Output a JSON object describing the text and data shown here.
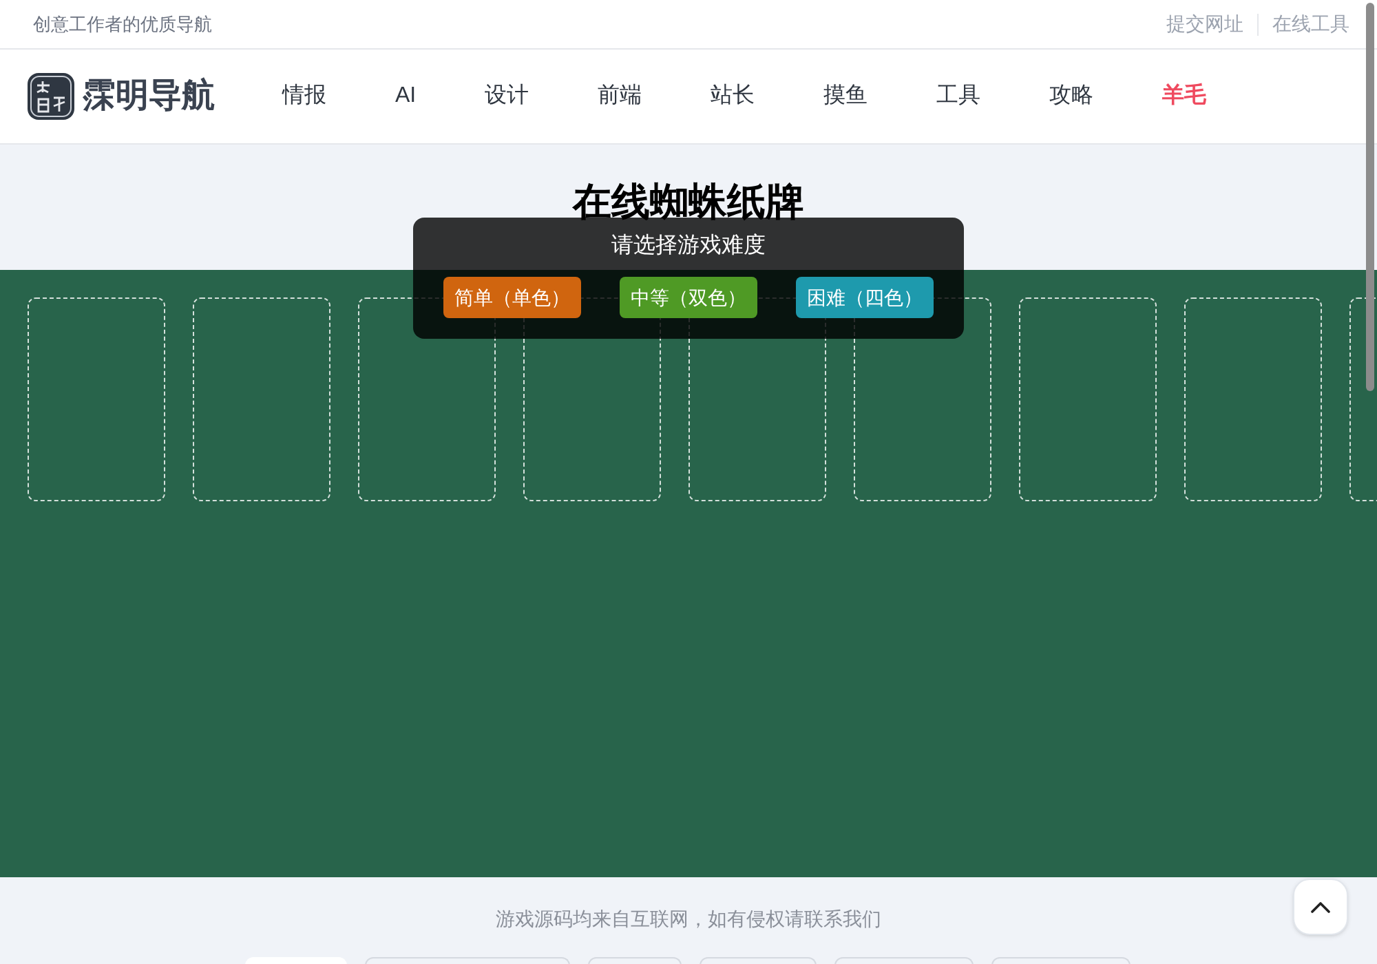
{
  "top_bar": {
    "tagline": "创意工作者的优质导航",
    "links": [
      "提交网址",
      "在线工具"
    ]
  },
  "header": {
    "logo_text": "霂明导航",
    "nav": [
      {
        "label": "情报",
        "highlighted": false
      },
      {
        "label": "AI",
        "highlighted": false
      },
      {
        "label": "设计",
        "highlighted": false
      },
      {
        "label": "前端",
        "highlighted": false
      },
      {
        "label": "站长",
        "highlighted": false
      },
      {
        "label": "摸鱼",
        "highlighted": false
      },
      {
        "label": "工具",
        "highlighted": false
      },
      {
        "label": "攻略",
        "highlighted": false
      },
      {
        "label": "羊毛",
        "highlighted": true
      }
    ]
  },
  "game": {
    "title": "在线蜘蛛纸牌",
    "dialog": {
      "title": "请选择游戏难度",
      "options": [
        {
          "label": "简单（单色）",
          "color": "#d0650f"
        },
        {
          "label": "中等（双色）",
          "color": "#4f9a25"
        },
        {
          "label": "困难（四色）",
          "color": "#1e9aad"
        }
      ]
    }
  },
  "footer": {
    "notice": "游戏源码均来自互联网，如有侵权请联系我们"
  }
}
